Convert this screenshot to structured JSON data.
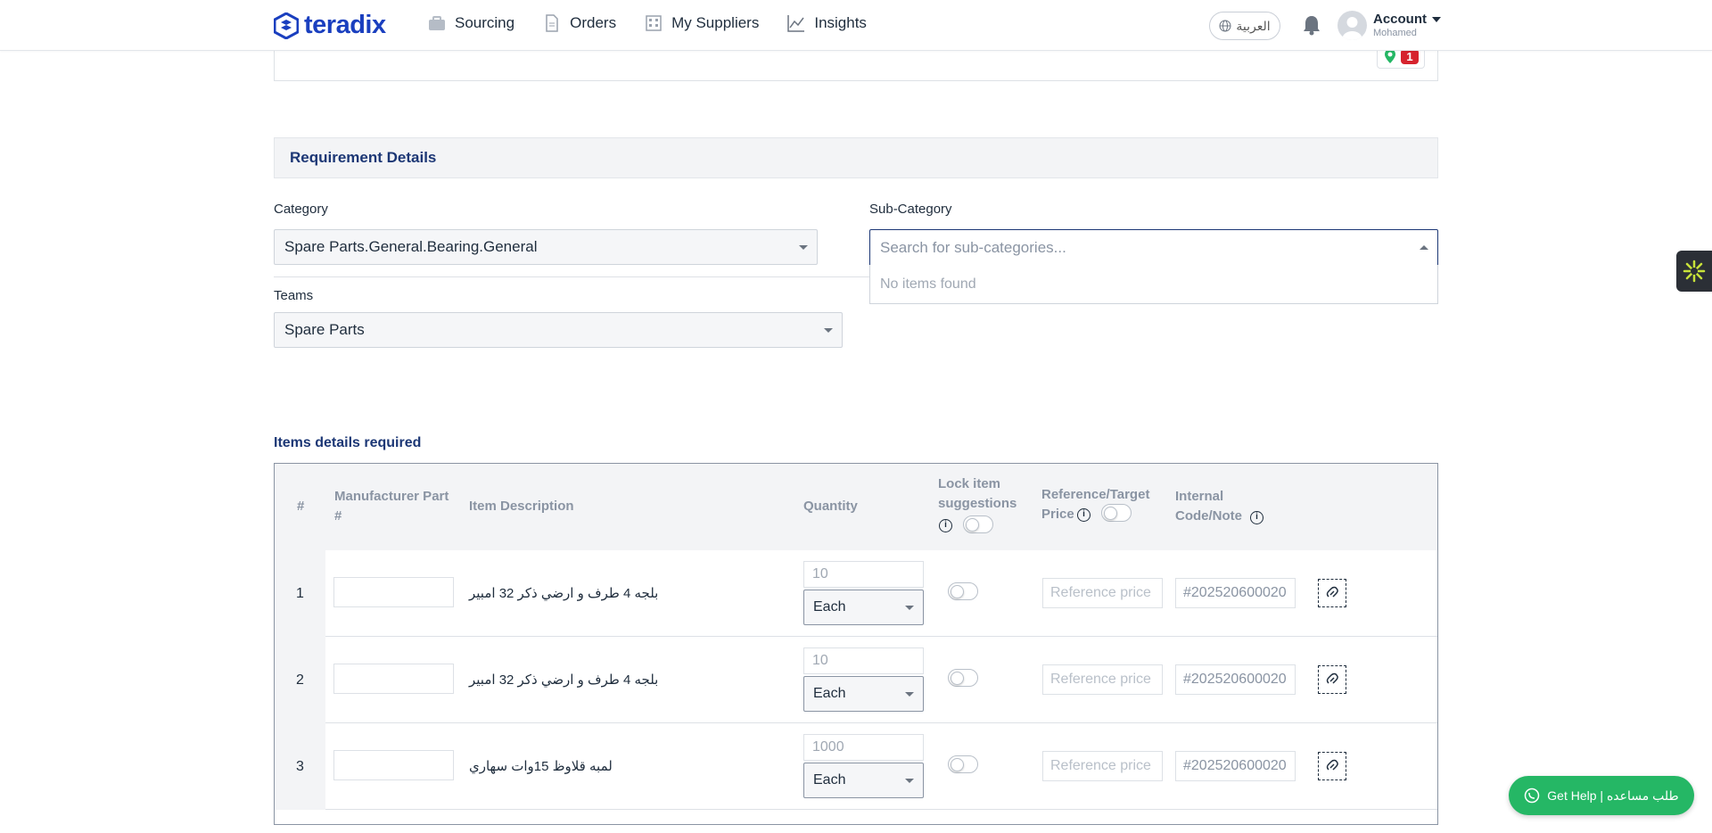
{
  "nav": {
    "logo_text": "teradix",
    "items": [
      {
        "label": "Sourcing",
        "icon": "briefcase-icon"
      },
      {
        "label": "Orders",
        "icon": "document-icon"
      },
      {
        "label": "My Suppliers",
        "icon": "building-icon"
      },
      {
        "label": "Insights",
        "icon": "chart-icon"
      }
    ],
    "language": "العربية",
    "account_label": "Account",
    "account_user": "Mohamed"
  },
  "prev_card": {
    "badge_count": "1"
  },
  "requirement": {
    "section_title": "Requirement Details",
    "category_label": "Category",
    "category_value": "Spare Parts.General.Bearing.General",
    "subcategory_label": "Sub-Category",
    "subcategory_placeholder": "Search for sub-categories...",
    "subcategory_empty": "No items found",
    "teams_label": "Teams",
    "teams_value": "Spare Parts"
  },
  "items": {
    "title": "Items details required",
    "headers": {
      "num": "#",
      "mpn": "Manufacturer Part #",
      "desc": "Item Description",
      "qty": "Quantity",
      "lock": "Lock item suggestions",
      "ref": "Reference/Target Price",
      "internal": "Internal Code/Note"
    },
    "rows": [
      {
        "num": "1",
        "desc": "بلجه 4 طرف و ارضي ذكر 32 امبير",
        "qty": "10",
        "unit": "Each",
        "ref_placeholder": "Reference price",
        "internal": "#202520600020"
      },
      {
        "num": "2",
        "desc": "بلجه 4 طرف و ارضي ذكر 32 امبير",
        "qty": "10",
        "unit": "Each",
        "ref_placeholder": "Reference price",
        "internal": "#202520600020"
      },
      {
        "num": "3",
        "desc": "لمبه قلاوظ 15وات سهاري",
        "qty": "1000",
        "unit": "Each",
        "ref_placeholder": "Reference price",
        "internal": "#202520600020"
      }
    ]
  },
  "help_button": "Get Help | طلب مساعده",
  "colors": {
    "brand": "#1a3fbf",
    "heading": "#1c3775",
    "help": "#25b765",
    "badge": "#d6232e"
  }
}
